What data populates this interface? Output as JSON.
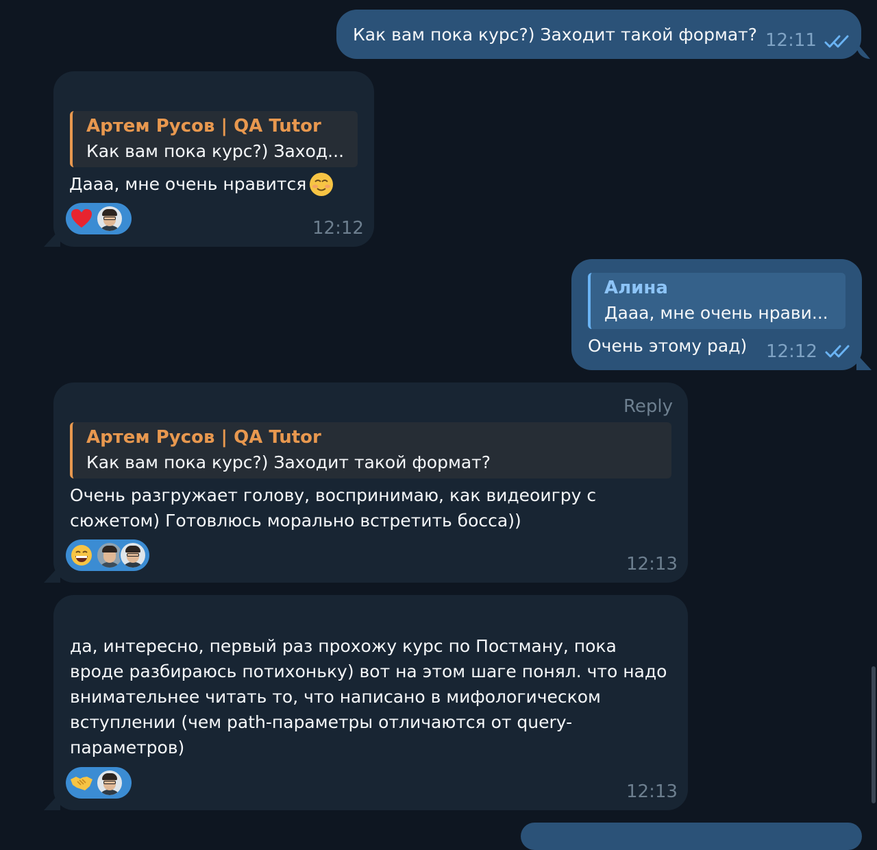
{
  "messages": [
    {
      "text": "Как вам пока курс?) Заходит такой формат?",
      "time": "12:11"
    },
    {
      "reply_name": "Артем Русов | QA Tutor",
      "reply_text": "Как вам пока курс?) Заход...",
      "text": "Дааа, мне очень нравится",
      "time": "12:12"
    },
    {
      "reply_name": "Алина",
      "reply_text": "Дааа, мне очень нрави...",
      "text": "Очень этому рад)",
      "time": "12:12"
    },
    {
      "reply_label": "Reply",
      "reply_name": "Артем Русов | QA Tutor",
      "reply_text": "Как вам пока курс?) Заходит такой формат?",
      "text_line1": "Очень разгружает голову, воспринимаю, как видеоигру с",
      "text_line2": "сюжетом) Готовлюсь морально встретить босса))",
      "time": "12:13"
    },
    {
      "text_line1": "да, интересно, первый раз прохожу курс по Постману, пока",
      "text_line2": "вроде разбираюсь потихоньку) вот на этом шаге понял. что надо",
      "text_line3": "внимательнее читать то, что написано в мифологическом",
      "text_line4": "вступлении (чем path-параметры отличаются от  query-",
      "text_line5": "параметров)",
      "time": "12:13"
    }
  ],
  "reactions": [
    "heart",
    "grinning-face",
    "handshake"
  ],
  "icons": [
    "double-check-icon",
    "smiling-face-icon"
  ],
  "colors": {
    "background": "#0e1621",
    "incoming": "#182533",
    "outgoing": "#2b5278",
    "reply_accent": "#e8984f",
    "reaction": "#3b8cd3"
  }
}
